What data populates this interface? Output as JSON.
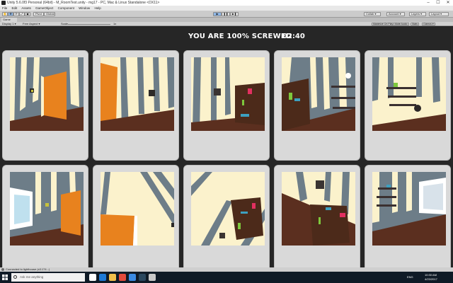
{
  "window": {
    "title": "Unity 5.6.0f3 Personal (64bit) - M_RoomTest.unity - mg17 - PC, Mac & Linux Standalone <DX11>",
    "minimize": "–",
    "maximize": "☐",
    "close": "✕"
  },
  "menu": {
    "items": [
      "File",
      "Edit",
      "Assets",
      "GameObject",
      "Component",
      "Window",
      "Help"
    ]
  },
  "toolbar": {
    "transform_tools": [
      "✋",
      "✥",
      "⟳",
      "⤢",
      "▣"
    ],
    "pivot_label": "Pivot",
    "global_label": "Global",
    "play": "▶",
    "pause": "❚❚",
    "step": "▶❚",
    "collab_label": "Collab ▾",
    "account_label": "Account ▾",
    "layers_label": "Layers ▾",
    "layout_label": "Layout ▾"
  },
  "game_tab": {
    "label": "Game",
    "display": "Display 1 ▾",
    "aspect": "Free Aspect ▾",
    "scale_label": "Scale",
    "scale_value": "1x",
    "maximize_on_play": "Maximize On Play",
    "mute_audio": "Mute Audio",
    "stats": "Stats",
    "gizmos": "Gizmos ▾"
  },
  "hud": {
    "title": "YOU ARE 100% SCREWED",
    "timer": "02:40"
  },
  "status": {
    "text": "Connected to lighthouse (s3.174...)"
  },
  "taskbar": {
    "search_placeholder": "Ask me anything",
    "time": "10:30 AM",
    "date": "4/23/2017",
    "lang": "ENG",
    "apps": [
      {
        "name": "task-view",
        "color": "#ffffff"
      },
      {
        "name": "edge",
        "color": "#1e7ad6"
      },
      {
        "name": "file-explorer",
        "color": "#f2c04b"
      },
      {
        "name": "chrome",
        "color": "#e34b3c"
      },
      {
        "name": "app",
        "color": "#3c8be3"
      },
      {
        "name": "steam",
        "color": "#2a475e"
      },
      {
        "name": "unity",
        "color": "#c9c9c9"
      }
    ]
  },
  "colors": {
    "wall_stripe_light": "#fbf2cc",
    "wall_stripe_dark": "#6d7d88",
    "floor": "#5b2f1f",
    "door": "#e8821e",
    "bookshelf": "#4c2a1a"
  }
}
